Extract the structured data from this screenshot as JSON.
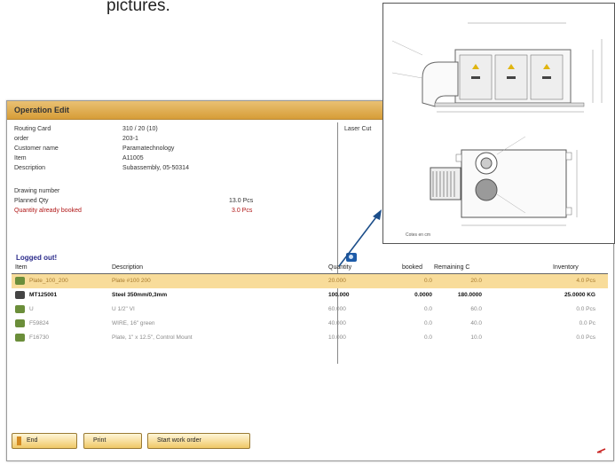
{
  "caption": "pictures.",
  "window": {
    "title": "Operation Edit",
    "laser_label": "Laser Cut",
    "logged_out": "Logged out!"
  },
  "fields": [
    {
      "label": "Routing Card",
      "value": "310 / 20  (10)"
    },
    {
      "label": "order",
      "value": "203-1"
    },
    {
      "label": "Customer name",
      "value": "Paramatechnology"
    },
    {
      "label": "Item",
      "value": "A11005"
    },
    {
      "label": "Description",
      "value": "Subassembly, 05-50314"
    }
  ],
  "drawing_number_label": "Drawing number",
  "planned": {
    "label": "Planned Qty",
    "value": "13.0  Pcs"
  },
  "booked_qty": {
    "label": "Quantity already booked",
    "value": "3.0  Pcs"
  },
  "grid": {
    "headers": [
      "Item",
      "Description",
      "Quantity",
      "booked",
      "Remaining C",
      "Inventory"
    ],
    "rows": [
      {
        "item": "Plate_100_200",
        "description": "Plate #100 200",
        "quantity": "20.000",
        "booked": "0.0",
        "remaining": "20.0",
        "inventory": "4.0  Pcs"
      },
      {
        "item": "MT125001",
        "description": "Steel 350mm/0,3mm",
        "quantity": "100.000",
        "booked": "0.0000",
        "remaining": "180.0000",
        "inventory": "25.0000  KG"
      },
      {
        "item": "U",
        "description": "U  1/2\" VI",
        "quantity": "60.000",
        "booked": "0.0",
        "remaining": "60.0",
        "inventory": "0.0  Pcs"
      },
      {
        "item": "F59824",
        "description": "WIRE, 16\" green",
        "quantity": "40.000",
        "booked": "0.0",
        "remaining": "40.0",
        "inventory": "0.0  Pc"
      },
      {
        "item": "F16730",
        "description": "Plate, 1\" x 12.5\", Control Mount",
        "quantity": "10.000",
        "booked": "0.0",
        "remaining": "10.0",
        "inventory": "0.0  Pcs"
      }
    ]
  },
  "buttons": {
    "end": "End",
    "print": "Print",
    "start": "Start work order"
  },
  "drawing": {
    "caption": "Cotes en cm"
  }
}
